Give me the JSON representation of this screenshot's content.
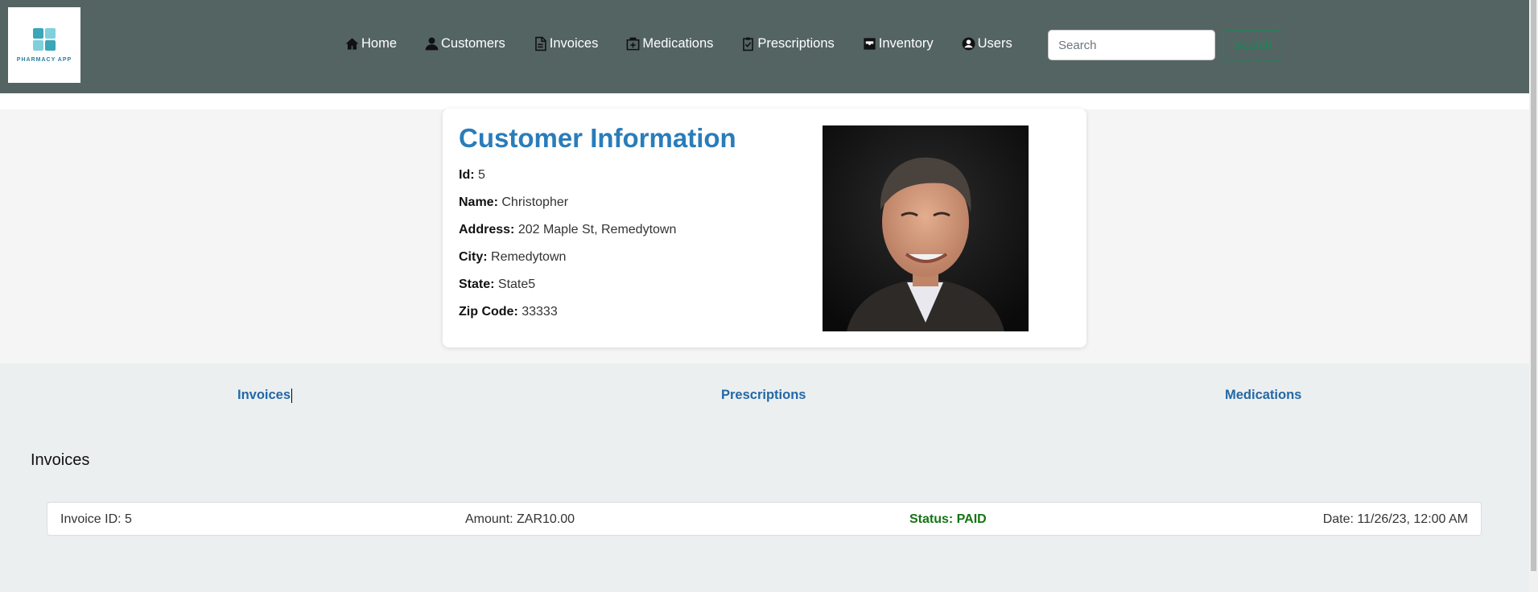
{
  "logo": {
    "text": "PHARMACY APP"
  },
  "nav": {
    "items": [
      {
        "label": "Home",
        "icon": "home-icon"
      },
      {
        "label": "Customers",
        "icon": "user-icon"
      },
      {
        "label": "Invoices",
        "icon": "document-icon"
      },
      {
        "label": "Medications",
        "icon": "medkit-icon"
      },
      {
        "label": "Prescriptions",
        "icon": "clipboard-check-icon"
      },
      {
        "label": "Inventory",
        "icon": "inbox-icon"
      },
      {
        "label": "Users",
        "icon": "user-circle-icon"
      }
    ],
    "search_placeholder": "Search",
    "search_button": "Search"
  },
  "customer": {
    "title": "Customer Information",
    "fields": [
      {
        "label": "Id:",
        "value": "5"
      },
      {
        "label": "Name:",
        "value": "Christopher"
      },
      {
        "label": "Address:",
        "value": "202 Maple St, Remedytown"
      },
      {
        "label": "City:",
        "value": "Remedytown"
      },
      {
        "label": "State:",
        "value": "State5"
      },
      {
        "label": "Zip Code:",
        "value": "33333"
      }
    ]
  },
  "tabs": [
    "Invoices",
    "Prescriptions",
    "Medications"
  ],
  "invoices": {
    "heading": "Invoices",
    "rows": [
      {
        "id": "Invoice ID: 5",
        "amount": "Amount: ZAR10.00",
        "status": "Status: PAID",
        "date": "Date: 11/26/23, 12:00 AM"
      }
    ]
  },
  "colors": {
    "navbar": "#546463",
    "title": "#2a7cba",
    "tab": "#2468a6",
    "status_paid": "#157515",
    "search_button": "#198754"
  }
}
